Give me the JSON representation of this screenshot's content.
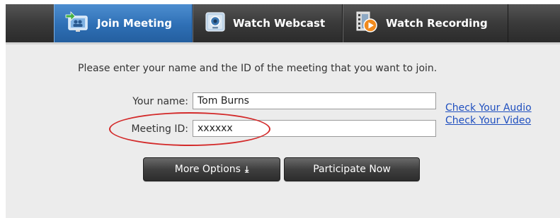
{
  "tabs": [
    {
      "label": "Join Meeting",
      "icon": "join-meeting-icon",
      "active": true
    },
    {
      "label": "Watch Webcast",
      "icon": "webcast-icon",
      "active": false
    },
    {
      "label": "Watch Recording",
      "icon": "recording-icon",
      "active": false
    }
  ],
  "form": {
    "instruction": "Please enter your name and the ID of the meeting that you want to join.",
    "name_label": "Your name:",
    "name_value": "Tom Burns",
    "meeting_id_label": "Meeting ID:",
    "meeting_id_value": "xxxxxx"
  },
  "links": {
    "check_audio": "Check Your Audio",
    "check_video": "Check Your Video"
  },
  "buttons": {
    "more_options": "More Options",
    "more_options_icon": "double-chevron-down-icon",
    "participate_now": "Participate Now"
  },
  "colors": {
    "active_tab": "#2e6fb5",
    "tab_bar": "#3a3a3a",
    "link": "#1f4fbf",
    "annotation": "#d32a2a"
  }
}
